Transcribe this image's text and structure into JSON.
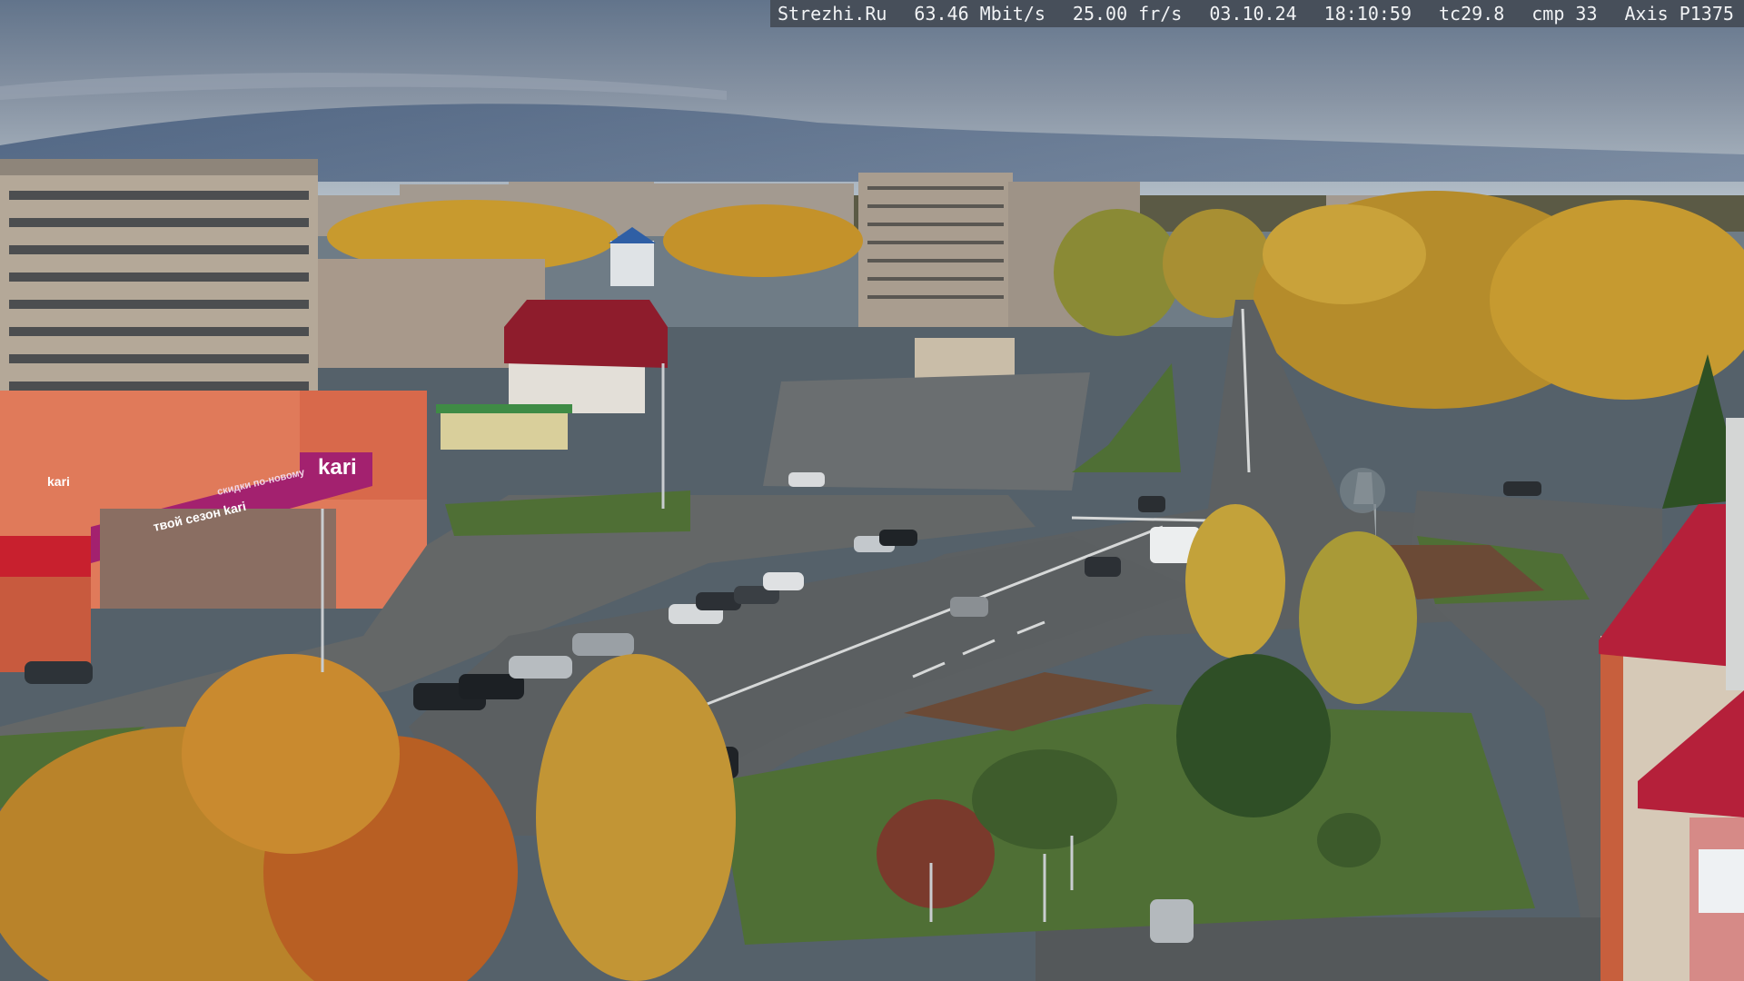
{
  "overlay": {
    "site": "Strezhi.Ru",
    "bitrate": "63.46 Mbit/s",
    "framerate": "25.00 fr/s",
    "date": "03.10.24",
    "time": "18:10:59",
    "tc": "tc29.8",
    "cmp": "cmp 33",
    "camera": "Axis P1375"
  },
  "signs": {
    "kari_main": "kari",
    "kari_tagline": "твой сезон kari",
    "kari_small": "kari",
    "kari_tagline2": "скидки по-новому"
  },
  "colors": {
    "sky_top": "#5d6f85",
    "sky_horizon": "#b4bfc8",
    "asphalt": "#5f6467",
    "grass": "#4f6f35",
    "birch_gold": "#c99a2c",
    "kari_magenta": "#a3216f",
    "roof_red": "#b5203a"
  }
}
